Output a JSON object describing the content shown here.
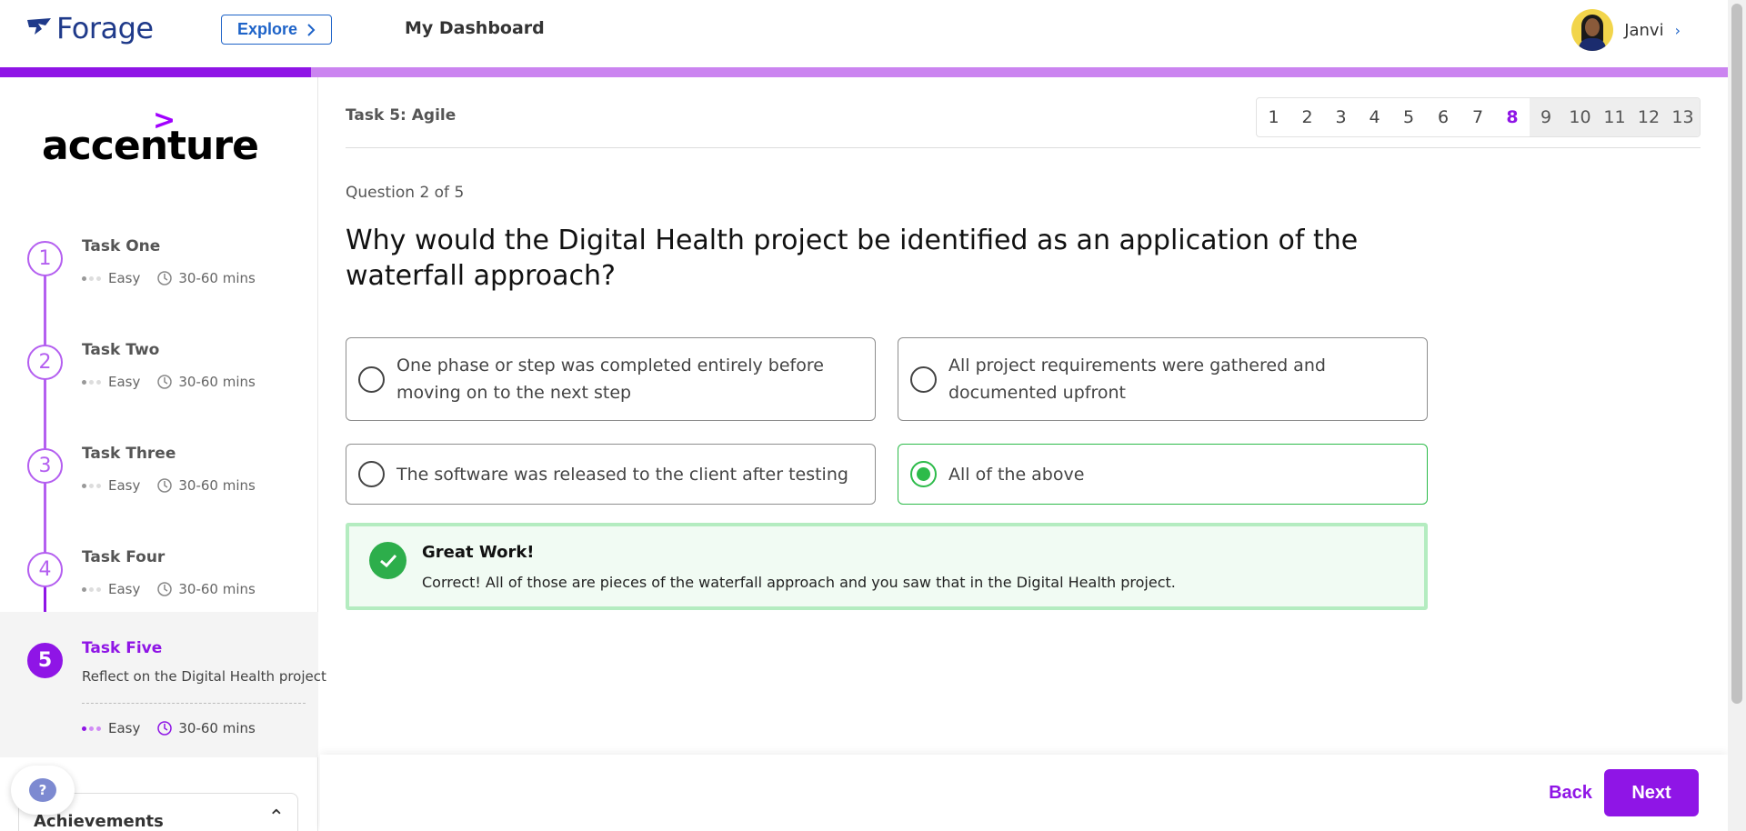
{
  "header": {
    "brand": "Forage",
    "explore_label": "Explore",
    "dashboard_label": "My Dashboard",
    "user_name": "Janvi"
  },
  "sidebar": {
    "company_logo": "accenture",
    "tasks": [
      {
        "number": "1",
        "title": "Task One",
        "difficulty": "Easy",
        "duration": "30-60 mins"
      },
      {
        "number": "2",
        "title": "Task Two",
        "difficulty": "Easy",
        "duration": "30-60 mins"
      },
      {
        "number": "3",
        "title": "Task Three",
        "difficulty": "Easy",
        "duration": "30-60 mins"
      },
      {
        "number": "4",
        "title": "Task Four",
        "difficulty": "Easy",
        "duration": "30-60 mins"
      },
      {
        "number": "5",
        "title": "Task Five",
        "subtitle": "Reflect on the Digital Health project",
        "difficulty": "Easy",
        "duration": "30-60 mins",
        "active": true
      }
    ],
    "help_label": "?",
    "achievements_label": "Achievements"
  },
  "main": {
    "task_label": "Task 5: Agile",
    "pager": {
      "pages": [
        "1",
        "2",
        "3",
        "4",
        "5",
        "6",
        "7",
        "8",
        "9",
        "10",
        "11",
        "12",
        "13"
      ],
      "current": "8"
    },
    "question_count": "Question 2 of 5",
    "question": "Why would the Digital Health project be identified as an application of the waterfall approach?",
    "options": [
      {
        "text": "One phase or step was completed entirely before moving on to the next step",
        "selected": false
      },
      {
        "text": "All project requirements were gathered and documented upfront",
        "selected": false
      },
      {
        "text": "The software was released to the client after testing",
        "selected": false
      },
      {
        "text": "All of the above",
        "selected": true
      }
    ],
    "feedback": {
      "title": "Great Work!",
      "text": "Correct! All of those are pieces of the waterfall approach and you saw that in the Digital Health project."
    }
  },
  "footer": {
    "back_label": "Back",
    "next_label": "Next"
  },
  "colors": {
    "brand_purple": "#8f15e6",
    "light_purple": "#cb84f0",
    "success_green": "#2dbb4a",
    "forage_blue": "#1f3a8a"
  },
  "progress_fraction": 0.18
}
